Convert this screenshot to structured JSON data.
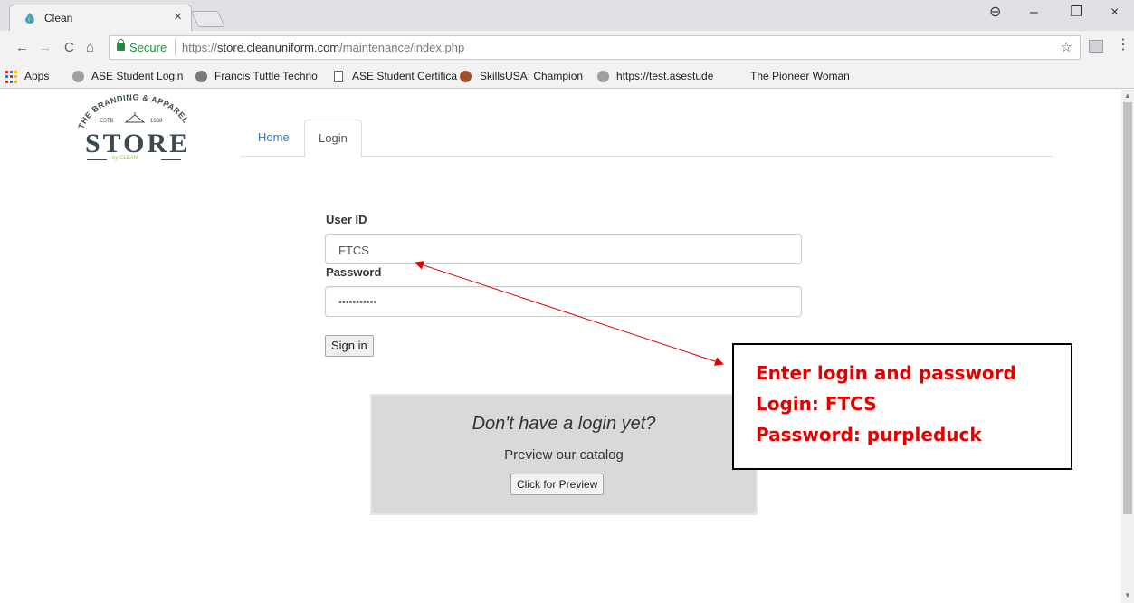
{
  "browser": {
    "tab_title": "Clean",
    "tab_close": "×",
    "window_controls": {
      "profile": "⊖",
      "minimize": "–",
      "maximize": "❐",
      "close": "×"
    },
    "nav": {
      "back": "←",
      "forward": "→",
      "reload": "C",
      "home": "⌂"
    },
    "security_label": "Secure",
    "url_scheme": "https://",
    "url_host": "store.cleanuniform.com",
    "url_path": "/maintenance/index.php",
    "star": "☆",
    "menu": "⋮",
    "bookmarks": [
      {
        "label": "Apps",
        "icon": "apps-grid-icon"
      },
      {
        "label": "ASE Student Login",
        "icon": "gear-icon"
      },
      {
        "label": "Francis Tuttle Techno",
        "icon": "ft-logo-icon"
      },
      {
        "label": "ASE Student Certifica",
        "icon": "page-icon"
      },
      {
        "label": "SkillsUSA: Champion",
        "icon": "skillsusa-icon"
      },
      {
        "label": "https://test.asestude",
        "icon": "gear-icon"
      },
      {
        "label": "The Pioneer Woman",
        "icon": "none"
      }
    ]
  },
  "logo": {
    "arc_text": "THE BRANDING & APPAREL",
    "estb": "ESTB",
    "year": "1938",
    "store": "STORE",
    "tag": "by CLEAN"
  },
  "nav_tabs": {
    "home": "Home",
    "login": "Login"
  },
  "login_form": {
    "user_id_label": "User ID",
    "user_id_value": "FTCS",
    "password_label": "Password",
    "password_value": "•••••••••••",
    "sign_in": "Sign in"
  },
  "preview": {
    "title": "Don't have a login yet?",
    "subtitle": "Preview our catalog",
    "button": "Click for Preview"
  },
  "annotation": {
    "line1": "Enter login and password",
    "line2": "Login: FTCS",
    "line3": "Password: purpleduck",
    "arrow_color": "#e00000"
  }
}
